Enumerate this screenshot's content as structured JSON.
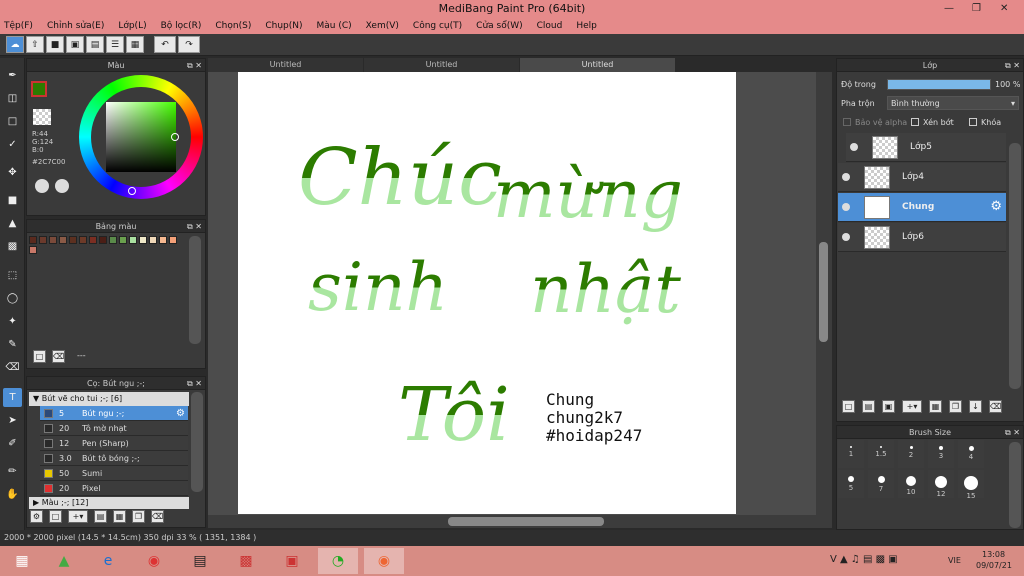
{
  "window": {
    "title": "MediBang Paint Pro (64bit)"
  },
  "menu": [
    "Tệp(F)",
    "Chỉnh sửa(E)",
    "Lớp(L)",
    "Bộ lọc(R)",
    "Chọn(S)",
    "Chụp(N)",
    "Màu (C)",
    "Xem(V)",
    "Công cụ(T)",
    "Cửa sổ(W)",
    "Cloud",
    "Help"
  ],
  "color_panel": {
    "title": "Màu",
    "r": "R:44",
    "g": "G:124",
    "b": "B:0",
    "hex": "#2C7C00",
    "fg_color": "#2c7c00"
  },
  "palette_panel": {
    "title": "Bảng màu",
    "footer": "---",
    "colors": [
      "#5a2a1e",
      "#6b3a2c",
      "#7a4a3a",
      "#8a5a46",
      "#5c3020",
      "#6d3a28",
      "#7b2e22",
      "#4a1e16",
      "#5a8a4a",
      "#6aa04e",
      "#a9e0a0",
      "#efe8c8",
      "#f0d8b8",
      "#f6b890",
      "#f4a078",
      "#c87868"
    ]
  },
  "brush_panel": {
    "title": "Cọ: Bút ngu ;-;",
    "group": "Bút vẽ cho tui ;-; [6]",
    "items": [
      {
        "size": "5",
        "name": "Bút ngu ;-;",
        "color": "#2c4a7a"
      },
      {
        "size": "20",
        "name": "Tô mờ nhạt",
        "color": "#2a2a2a"
      },
      {
        "size": "12",
        "name": "Pen (Sharp)",
        "color": "#2a2a2a"
      },
      {
        "size": "3.0",
        "name": "Bút tô bóng ;-;",
        "color": "#2a2a2a"
      },
      {
        "size": "50",
        "name": "Sumi",
        "color": "#e8c800"
      },
      {
        "size": "20",
        "name": "Pixel",
        "color": "#e03030"
      }
    ],
    "group2": "Màu ;-; [12]"
  },
  "tabs": [
    "Untitled",
    "Untitled",
    "Untitled"
  ],
  "canvas": {
    "line1a": "Chúc",
    "line1b": "mừng",
    "line2a": "sinh",
    "line2b": "nhật",
    "line3": "Tôi",
    "sig1": "Chung",
    "sig2": "chung2k7",
    "sig3": "#hoidap247"
  },
  "layer_panel": {
    "title": "Lớp",
    "opacity_label": "Độ trong",
    "opacity_value": "100 %",
    "opacity_fraction": 1.0,
    "blend_label": "Pha trộn",
    "blend_value": "Bình thường",
    "protect_alpha": "Bảo vệ alpha",
    "clipping": "Xén bớt",
    "lock": "Khóa",
    "layers": [
      "Lớp5",
      "Lớp4",
      "Chung",
      "Lớp6"
    ]
  },
  "brush_size_panel": {
    "title": "Brush Size",
    "sizes": [
      "1",
      "1.5",
      "2",
      "3",
      "4",
      "5",
      "7",
      "10",
      "12",
      "15"
    ]
  },
  "status": "2000 * 2000 pixel   (14.5 * 14.5cm)   350 dpi   33 %   ( 1351, 1384 )",
  "taskbar": {
    "lang": "VIE",
    "time": "13:08",
    "date": "09/07/21"
  }
}
